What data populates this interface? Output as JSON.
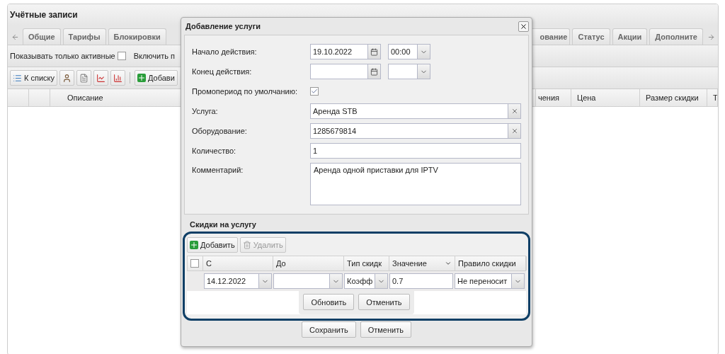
{
  "window": {
    "title": "Учётные записи"
  },
  "tabs": {
    "left": [
      {
        "label": "Общие",
        "selected": false
      },
      {
        "label": "Тарифы",
        "selected": false
      },
      {
        "label": "Блокировки",
        "selected": false
      }
    ],
    "right": [
      {
        "label": "ование",
        "selected": false
      },
      {
        "label": "Статус",
        "selected": false
      },
      {
        "label": "Акции",
        "selected": false
      },
      {
        "label": "Дополните",
        "selected": false
      }
    ]
  },
  "filters": [
    {
      "kind": "checkbox",
      "label": "Показывать только активные",
      "checked": false
    },
    {
      "kind": "text",
      "label": "Включить п"
    }
  ],
  "toolbar": {
    "list_button": "К списку",
    "add_button": "Добави"
  },
  "grid": {
    "columns_left": [
      "Описание"
    ],
    "columns_right": [
      "чения",
      "Цена",
      "Размер скидки",
      "Т"
    ]
  },
  "dialog": {
    "title": "Добавление услуги",
    "fields": [
      {
        "kind": "datetime",
        "label": "Начало действия:",
        "date": "19.10.2022",
        "time": "00:00"
      },
      {
        "kind": "datetime",
        "label": "Конец действия:"
      },
      {
        "kind": "checkbox",
        "label": "Промопериод по умолчанию:",
        "checked": true
      },
      {
        "kind": "clearable",
        "label": "Услуга:",
        "value": "Аренда STB"
      },
      {
        "kind": "clearable",
        "label": "Оборудование:",
        "value": "1285679814"
      },
      {
        "kind": "text",
        "label": "Количество:",
        "value": "1"
      },
      {
        "kind": "textarea",
        "label": "Комментарий:",
        "value": "Аренда одной приставки для IPTV"
      }
    ],
    "discounts": {
      "title": "Скидки на услугу",
      "buttons": [
        {
          "label": "Добавить",
          "disabled": false
        },
        {
          "label": "Удалить",
          "disabled": true
        }
      ],
      "select_all": {
        "checked": false
      },
      "columns": [
        "С",
        "До",
        "Тип скидк",
        "Значение",
        "Правило скидки"
      ],
      "row": {
        "from": "14.12.2022",
        "type": "Коэфф",
        "value": "0.7",
        "rule": "Не переносит"
      },
      "editor_buttons": [
        "Обновить",
        "Отменить"
      ]
    },
    "buttons": [
      "Сохранить",
      "Отменить"
    ]
  }
}
